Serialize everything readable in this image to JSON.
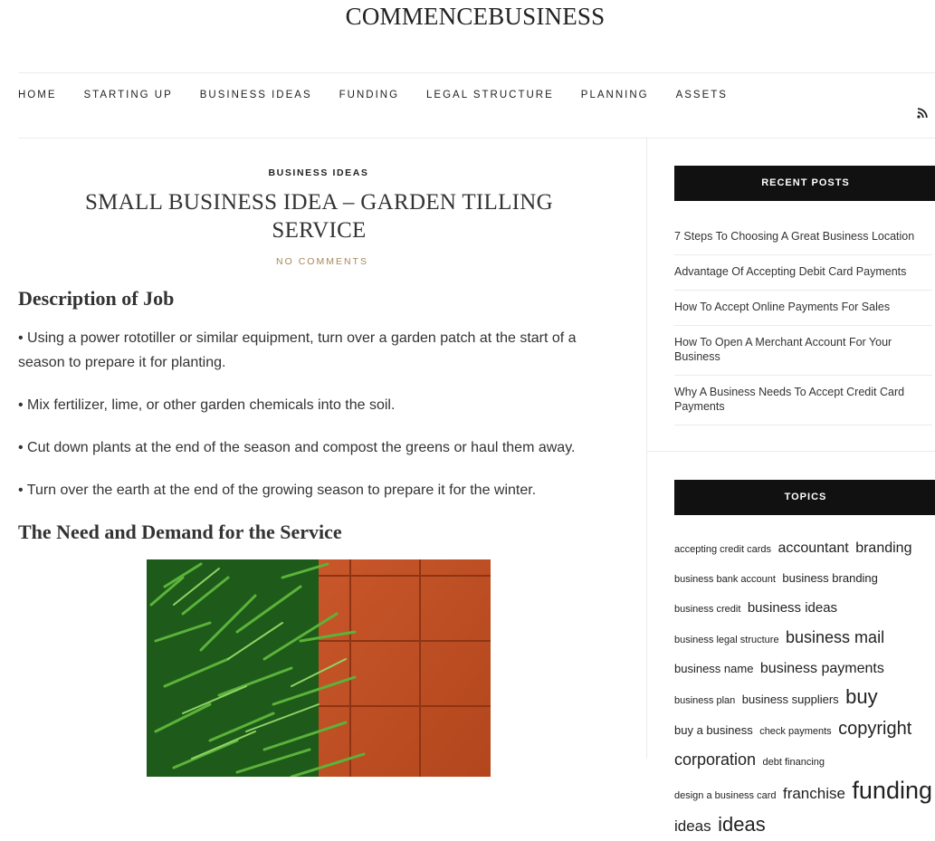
{
  "site": {
    "title": "COMMENCEBUSINESS"
  },
  "nav": {
    "items": [
      "HOME",
      "STARTING UP",
      "BUSINESS IDEAS",
      "FUNDING",
      "LEGAL STRUCTURE",
      "PLANNING",
      "ASSETS"
    ],
    "rss_icon": "rss-icon"
  },
  "post": {
    "category": "BUSINESS IDEAS",
    "title": "SMALL BUSINESS IDEA – GARDEN TILLING SERVICE",
    "comments": "NO COMMENTS",
    "heading1": "Description of Job",
    "bullets": [
      "• Using a power rototiller or similar equipment, turn over a garden patch at the start of a season to prepare it for planting.",
      "• Mix fertilizer, lime, or other garden chemicals into the soil.",
      "• Cut down plants at the end of the season and compost the greens or haul them away.",
      "• Turn over the earth at the end of the growing season to prepare it for the winter."
    ],
    "heading2": "The Need and Demand for the Service"
  },
  "sidebar": {
    "recent_title": "RECENT POSTS",
    "recent_posts": [
      "7 Steps To Choosing A Great Business Location",
      "Advantage Of Accepting Debit Card Payments",
      "How To Accept Online Payments For Sales",
      "How To Open A Merchant Account For Your Business",
      "Why A Business Needs To Accept Credit Card Payments"
    ],
    "topics_title": "TOPICS",
    "tags": [
      {
        "text": "accepting credit cards",
        "size": 11
      },
      {
        "text": "accountant",
        "size": 16
      },
      {
        "text": "branding",
        "size": 16
      },
      {
        "text": "business bank account",
        "size": 11
      },
      {
        "text": "business branding",
        "size": 13
      },
      {
        "text": "business credit",
        "size": 11
      },
      {
        "text": "business ideas",
        "size": 15
      },
      {
        "text": "business legal structure",
        "size": 11
      },
      {
        "text": "business mail",
        "size": 18
      },
      {
        "text": "business name",
        "size": 13
      },
      {
        "text": "business payments",
        "size": 16
      },
      {
        "text": "business plan",
        "size": 11
      },
      {
        "text": "business suppliers",
        "size": 13
      },
      {
        "text": "buy",
        "size": 22
      },
      {
        "text": "buy a business",
        "size": 13
      },
      {
        "text": "check payments",
        "size": 11
      },
      {
        "text": "copyright",
        "size": 20
      },
      {
        "text": "corporation",
        "size": 18
      },
      {
        "text": "debt financing",
        "size": 11
      },
      {
        "text": "design a business card",
        "size": 11
      },
      {
        "text": "franchise",
        "size": 17
      },
      {
        "text": "funding",
        "size": 27
      },
      {
        "text": "ideas",
        "size": 17
      },
      {
        "text": "ideas",
        "size": 22
      }
    ]
  }
}
